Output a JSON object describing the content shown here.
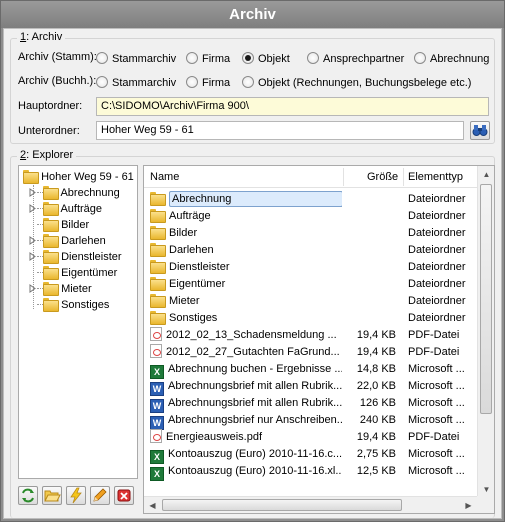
{
  "window": {
    "title": "Archiv"
  },
  "archiv": {
    "group_prefix": "1",
    "group_title": ": Archiv",
    "stamm_label": "Archiv (Stamm):",
    "stamm_options": [
      "Stammarchiv",
      "Firma",
      "Objekt",
      "Ansprechpartner",
      "Abrechnung"
    ],
    "stamm_selected": "Objekt",
    "buchh_label": "Archiv (Buchh.):",
    "buchh_options": [
      "Stammarchiv",
      "Firma",
      "Objekt (Rechnungen, Buchungsbelege etc.)"
    ],
    "buchh_selected": "",
    "hauptordner_label": "Hauptordner:",
    "hauptordner_value": "C:\\SIDOMO\\Archiv\\Firma 900\\",
    "unterordner_label": "Unterordner:",
    "unterordner_value": "Hoher Weg 59 - 61"
  },
  "explorer": {
    "group_prefix": "2",
    "group_title": ": Explorer",
    "tree": {
      "root": "Hoher Weg 59 - 61",
      "children": [
        {
          "label": "Abrechnung",
          "expandable": true
        },
        {
          "label": "Aufträge",
          "expandable": true
        },
        {
          "label": "Bilder",
          "expandable": false
        },
        {
          "label": "Darlehen",
          "expandable": true
        },
        {
          "label": "Dienstleister",
          "expandable": true
        },
        {
          "label": "Eigentümer",
          "expandable": false
        },
        {
          "label": "Mieter",
          "expandable": true
        },
        {
          "label": "Sonstiges",
          "expandable": false
        }
      ]
    },
    "columns": {
      "name": "Name",
      "size": "Größe",
      "type": "Elementtyp"
    },
    "rows": [
      {
        "name": "Abrechnung",
        "size": "",
        "type": "Dateiordner",
        "icon": "folder-icon",
        "selected": true
      },
      {
        "name": "Aufträge",
        "size": "",
        "type": "Dateiordner",
        "icon": "folder-icon"
      },
      {
        "name": "Bilder",
        "size": "",
        "type": "Dateiordner",
        "icon": "folder-icon"
      },
      {
        "name": "Darlehen",
        "size": "",
        "type": "Dateiordner",
        "icon": "folder-icon"
      },
      {
        "name": "Dienstleister",
        "size": "",
        "type": "Dateiordner",
        "icon": "folder-icon"
      },
      {
        "name": "Eigentümer",
        "size": "",
        "type": "Dateiordner",
        "icon": "folder-icon"
      },
      {
        "name": "Mieter",
        "size": "",
        "type": "Dateiordner",
        "icon": "folder-icon"
      },
      {
        "name": "Sonstiges",
        "size": "",
        "type": "Dateiordner",
        "icon": "folder-icon"
      },
      {
        "name": "2012_02_13_Schadensmeldung ...",
        "size": "19,4 KB",
        "type": "PDF-Datei",
        "icon": "pdf-icon"
      },
      {
        "name": "2012_02_27_Gutachten FaGrund...",
        "size": "19,4 KB",
        "type": "PDF-Datei",
        "icon": "pdf-icon"
      },
      {
        "name": "Abrechnung buchen - Ergebnisse ...",
        "size": "14,8 KB",
        "type": "Microsoft ...",
        "icon": "excel-icon"
      },
      {
        "name": "Abrechnungsbrief mit allen Rubrik...",
        "size": "22,0 KB",
        "type": "Microsoft ...",
        "icon": "word-icon"
      },
      {
        "name": "Abrechnungsbrief mit allen Rubrik...",
        "size": "126 KB",
        "type": "Microsoft ...",
        "icon": "word-icon"
      },
      {
        "name": "Abrechnungsbrief nur Anschreiben...",
        "size": "240 KB",
        "type": "Microsoft ...",
        "icon": "word-icon"
      },
      {
        "name": "Energieausweis.pdf",
        "size": "19,4 KB",
        "type": "PDF-Datei",
        "icon": "pdf-icon"
      },
      {
        "name": "Kontoauszug  (Euro) 2010-11-16.c...",
        "size": "2,75 KB",
        "type": "Microsoft ...",
        "icon": "excel-icon"
      },
      {
        "name": "Kontoauszug  (Euro) 2010-11-16.xl...",
        "size": "12,5 KB",
        "type": "Microsoft ...",
        "icon": "excel-icon"
      }
    ],
    "toolbar_icons": [
      "refresh-icon",
      "open-folder-icon",
      "lightning-icon",
      "pencil-icon",
      "delete-icon"
    ]
  },
  "colors": {
    "titlebar": "#8e8e8e",
    "readonly_field": "#fdfbd8",
    "selection": "#dcebfc"
  }
}
